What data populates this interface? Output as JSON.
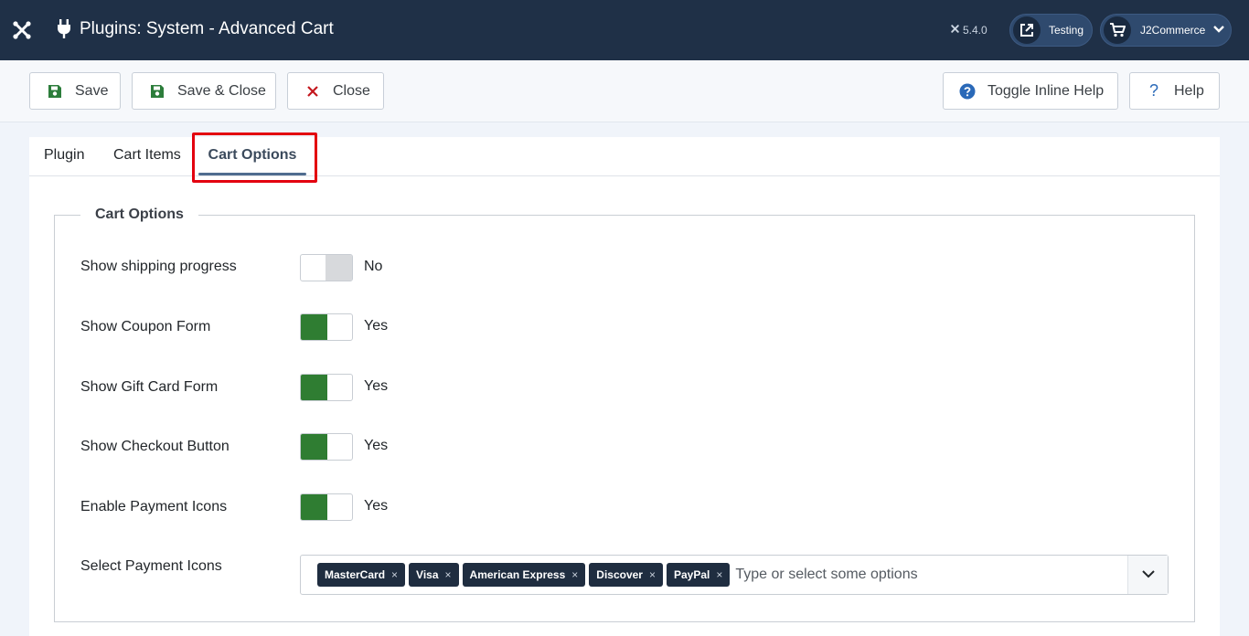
{
  "header": {
    "title": "Plugins: System - Advanced Cart",
    "version": "5.4.0",
    "preview_label": "Testing",
    "user_label": "J2Commerce"
  },
  "toolbar": {
    "save_label": "Save",
    "save_close_label": "Save & Close",
    "close_label": "Close",
    "toggle_help_label": "Toggle Inline Help",
    "help_label": "Help"
  },
  "tabs": [
    {
      "label": "Plugin",
      "active": false
    },
    {
      "label": "Cart Items",
      "active": false
    },
    {
      "label": "Cart Options",
      "active": true
    }
  ],
  "fieldset": {
    "legend": "Cart Options",
    "fields": [
      {
        "label": "Show shipping progress",
        "value": "No",
        "on": false
      },
      {
        "label": "Show Coupon Form",
        "value": "Yes",
        "on": true
      },
      {
        "label": "Show Gift Card Form",
        "value": "Yes",
        "on": true
      },
      {
        "label": "Show Checkout Button",
        "value": "Yes",
        "on": true
      },
      {
        "label": "Enable Payment Icons",
        "value": "Yes",
        "on": true
      }
    ],
    "payment_icons": {
      "label": "Select Payment Icons",
      "selected": [
        "MasterCard",
        "Visa",
        "American Express",
        "Discover",
        "PayPal"
      ],
      "placeholder": "Type or select some options"
    }
  },
  "colors": {
    "header_bg": "#1f3047",
    "switch_on": "#2f7d32",
    "highlight": "#e3000f"
  }
}
